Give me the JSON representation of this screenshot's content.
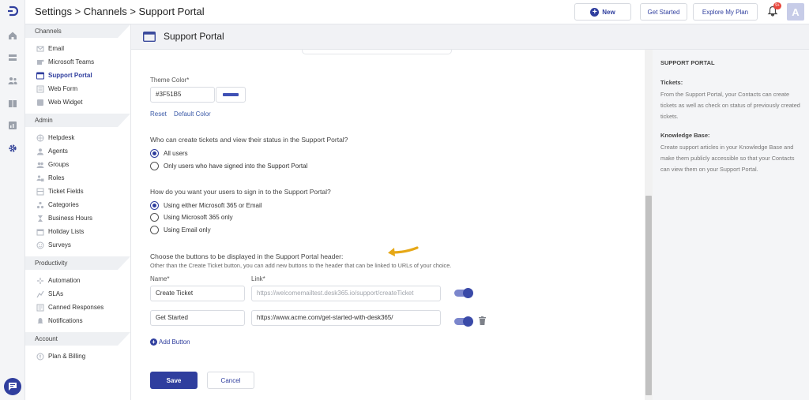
{
  "header": {
    "breadcrumb": "Settings > Channels > Support Portal",
    "new_label": "New",
    "get_started_label": "Get Started",
    "explore_plan_label": "Explore My Plan",
    "notification_badge": "9+",
    "avatar_initial": "A"
  },
  "sidebar": {
    "sections": [
      {
        "title": "Channels",
        "items": [
          {
            "label": "Email",
            "icon": "email-icon"
          },
          {
            "label": "Microsoft Teams",
            "icon": "teams-icon"
          },
          {
            "label": "Support Portal",
            "icon": "portal-icon",
            "active": true
          },
          {
            "label": "Web Form",
            "icon": "form-icon"
          },
          {
            "label": "Web Widget",
            "icon": "widget-icon"
          }
        ]
      },
      {
        "title": "Admin",
        "items": [
          {
            "label": "Helpdesk",
            "icon": "helpdesk-icon"
          },
          {
            "label": "Agents",
            "icon": "agents-icon"
          },
          {
            "label": "Groups",
            "icon": "groups-icon"
          },
          {
            "label": "Roles",
            "icon": "roles-icon"
          },
          {
            "label": "Ticket Fields",
            "icon": "fields-icon"
          },
          {
            "label": "Categories",
            "icon": "categories-icon"
          },
          {
            "label": "Business Hours",
            "icon": "hourglass-icon"
          },
          {
            "label": "Holiday Lists",
            "icon": "calendar-icon"
          },
          {
            "label": "Surveys",
            "icon": "smiley-icon"
          }
        ]
      },
      {
        "title": "Productivity",
        "items": [
          {
            "label": "Automation",
            "icon": "automation-icon"
          },
          {
            "label": "SLAs",
            "icon": "sla-icon"
          },
          {
            "label": "Canned Responses",
            "icon": "canned-icon"
          },
          {
            "label": "Notifications",
            "icon": "bell-icon"
          }
        ]
      },
      {
        "title": "Account",
        "items": [
          {
            "label": "Plan & Billing",
            "icon": "billing-icon"
          }
        ]
      }
    ]
  },
  "main": {
    "page_title": "Support Portal",
    "theme_color_label": "Theme Color*",
    "theme_color_value": "#3F51B5",
    "theme_color": "#3F51B5",
    "reset_label": "Reset",
    "default_color_label": "Default Color",
    "q_create": "Who can create tickets and view their status in the Support Portal?",
    "create_options": [
      {
        "label": "All users",
        "selected": true
      },
      {
        "label": "Only users who have signed into the Support Portal",
        "selected": false
      }
    ],
    "q_signin": "How do you want your users to sign in to the Support Portal?",
    "signin_options": [
      {
        "label": "Using either Microsoft 365 or Email",
        "selected": true
      },
      {
        "label": "Using Microsoft 365 only",
        "selected": false
      },
      {
        "label": "Using Email only",
        "selected": false
      }
    ],
    "q_buttons": "Choose the buttons to be displayed in the Support Portal header:",
    "buttons_sub": "Other than the Create Ticket button, you can add new buttons to the header that can be linked to URLs of your choice.",
    "name_col": "Name*",
    "link_col": "Link*",
    "rows": [
      {
        "name": "Create Ticket",
        "link": "https://welcomemailtest.desk365.io/support/createTicket",
        "enabled": true
      },
      {
        "name": "Get Started",
        "link": "https://www.acme.com/get-started-with-desk365/",
        "enabled": true
      }
    ],
    "add_button_label": "Add Button",
    "save_label": "Save",
    "cancel_label": "Cancel"
  },
  "help": {
    "title": "SUPPORT PORTAL",
    "tickets_heading": "Tickets:",
    "tickets_text": "From the Support Portal, your Contacts can create tickets as well as check on status of previously created tickets.",
    "kb_heading": "Knowledge Base:",
    "kb_text": "Create support articles in your Knowledge Base and make them publicly accessible so that your Contacts can view them on your Support Portal."
  }
}
